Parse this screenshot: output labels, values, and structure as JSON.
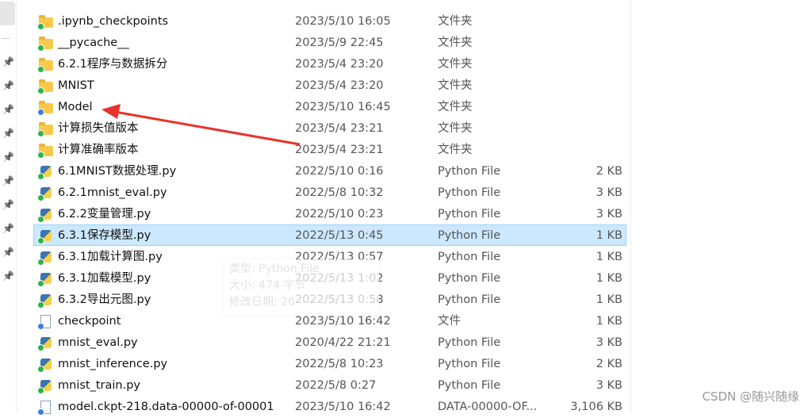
{
  "files": [
    {
      "name": ".ipynb_checkpoints",
      "date": "2023/5/10 16:05",
      "type": "文件夹",
      "size": "",
      "icon": "folder",
      "status": "synced"
    },
    {
      "name": "__pycache__",
      "date": "2023/5/9 22:45",
      "type": "文件夹",
      "size": "",
      "icon": "folder",
      "status": "synced"
    },
    {
      "name": "6.2.1程序与数据拆分",
      "date": "2023/5/4 23:20",
      "type": "文件夹",
      "size": "",
      "icon": "folder",
      "status": "synced"
    },
    {
      "name": "MNIST",
      "date": "2023/5/4 23:20",
      "type": "文件夹",
      "size": "",
      "icon": "folder",
      "status": "synced"
    },
    {
      "name": "Model",
      "date": "2023/5/10 16:45",
      "type": "文件夹",
      "size": "",
      "icon": "folder",
      "status": "syncing"
    },
    {
      "name": "计算损失值版本",
      "date": "2023/5/4 23:21",
      "type": "文件夹",
      "size": "",
      "icon": "folder",
      "status": "synced"
    },
    {
      "name": "计算准确率版本",
      "date": "2023/5/4 23:21",
      "type": "文件夹",
      "size": "",
      "icon": "folder",
      "status": "synced"
    },
    {
      "name": "6.1MNIST数据处理.py",
      "date": "2022/5/10 0:16",
      "type": "Python File",
      "size": "2 KB",
      "icon": "python",
      "status": "synced"
    },
    {
      "name": "6.2.1mnist_eval.py",
      "date": "2022/5/8 10:32",
      "type": "Python File",
      "size": "3 KB",
      "icon": "python",
      "status": "synced"
    },
    {
      "name": "6.2.2变量管理.py",
      "date": "2022/5/10 0:23",
      "type": "Python File",
      "size": "3 KB",
      "icon": "python",
      "status": "synced"
    },
    {
      "name": "6.3.1保存模型.py",
      "date": "2022/5/13 0:45",
      "type": "Python File",
      "size": "1 KB",
      "icon": "python",
      "status": "synced",
      "selected": true
    },
    {
      "name": "6.3.1加载计算图.py",
      "date": "2022/5/13 0:57",
      "type": "Python File",
      "size": "1 KB",
      "icon": "python",
      "status": "synced"
    },
    {
      "name": "6.3.1加载模型.py",
      "date": "2022/5/13 1:02",
      "type": "Python File",
      "size": "1 KB",
      "icon": "python",
      "status": "synced"
    },
    {
      "name": "6.3.2导出元图.py",
      "date": "2022/5/13 0:58",
      "type": "Python File",
      "size": "1 KB",
      "icon": "python",
      "status": "synced"
    },
    {
      "name": "checkpoint",
      "date": "2023/5/10 16:42",
      "type": "文件",
      "size": "1 KB",
      "icon": "file",
      "status": "syncing"
    },
    {
      "name": "mnist_eval.py",
      "date": "2020/4/22 21:21",
      "type": "Python File",
      "size": "3 KB",
      "icon": "python",
      "status": "synced"
    },
    {
      "name": "mnist_inference.py",
      "date": "2022/5/8 10:23",
      "type": "Python File",
      "size": "2 KB",
      "icon": "python",
      "status": "synced"
    },
    {
      "name": "mnist_train.py",
      "date": "2022/5/8 0:27",
      "type": "Python File",
      "size": "3 KB",
      "icon": "python",
      "status": "synced"
    },
    {
      "name": "model.ckpt-218.data-00000-of-00001",
      "date": "2023/5/10 16:42",
      "type": "DATA-00000-OF...",
      "size": "3,106 KB",
      "icon": "file",
      "status": "syncing"
    }
  ],
  "tooltip": {
    "type": "类型: Python File",
    "size": "大小: 474 字节",
    "modified": "修改日期: 20"
  },
  "watermark": "CSDN @随兴随缘",
  "colors": {
    "selection": "#cce8ff",
    "arrow": "#e8322e",
    "synced": "#2fb24b",
    "syncing": "#3f7fe0"
  }
}
